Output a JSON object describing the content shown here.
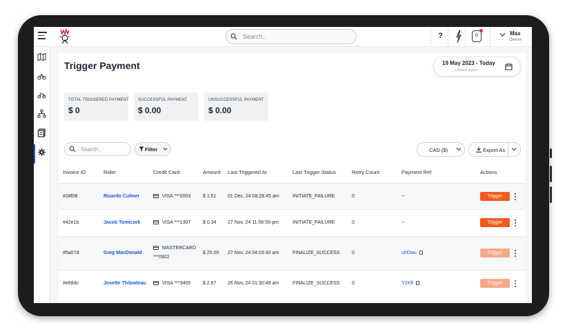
{
  "topbar": {
    "search_placeholder": "Search..",
    "help_label": "?",
    "notification_count": "0",
    "user_name": "Max",
    "user_role": "Owner"
  },
  "page": {
    "title": "Trigger Payment",
    "date_range": "19 May 2023 - Today",
    "date_caption": "Lifetime report"
  },
  "stats": [
    {
      "label": "Total Triggered Payment",
      "value": "$ 0"
    },
    {
      "label": "Successful Payment",
      "value": "$ 0.00"
    },
    {
      "label": "Unsuccessful Payment",
      "value": "$ 0.00"
    }
  ],
  "toolbar": {
    "search_placeholder": "Search..",
    "filter_label": "Filter",
    "currency_label": "CAD ($)",
    "export_label": "Export As"
  },
  "table": {
    "headers": [
      "Invoice ID",
      "Rider",
      "Credit Card",
      "Amount",
      "Last Triggered At",
      "Last Trigger Status",
      "Retry Count",
      "Payment Ref",
      "Actions"
    ],
    "rows": [
      {
        "invoice": "#28f08",
        "rider": "Ricardo Culmer",
        "card": "VISA ***2003",
        "card2": "",
        "amount": "$ 1.51",
        "triggered": "01 Dec, 24 08:26:45 am",
        "status": "INITIATE_FAILURE",
        "retry": "0",
        "ref": "--",
        "action": "Trigger"
      },
      {
        "invoice": "#42e1b",
        "rider": "Jacob Tomiczek",
        "card": "VISA ***1307",
        "card2": "",
        "amount": "$ 0.34",
        "triggered": "27 Nov, 24 11:56:59 pm",
        "status": "INITIATE_FAILURE",
        "retry": "0",
        "ref": "--",
        "action": "Trigger"
      },
      {
        "invoice": "#5a07d",
        "rider": "Greg MacDonald",
        "card": "MASTERCARD",
        "card2": "***0922",
        "amount": "$ 25.00",
        "triggered": "27 Nov, 24 04:03:43 am",
        "status": "FINALIZE_SUCCESS",
        "retry": "0",
        "ref": "uhDwu",
        "action": "Trigger"
      },
      {
        "invoice": "#e68dc",
        "rider": "Josette Thibodeau",
        "card": "VISA ***3405",
        "card2": "",
        "amount": "$ 2.67",
        "triggered": "26 Nov, 24 01:30:49 am",
        "status": "FINALIZE_SUCCESS",
        "retry": "0",
        "ref": "Y2Kfl",
        "action": "Trigger"
      }
    ]
  },
  "colors": {
    "accent_blue": "#1a56db",
    "trigger_active": "#f15a1e",
    "trigger_disabled": "#f6a98a"
  }
}
